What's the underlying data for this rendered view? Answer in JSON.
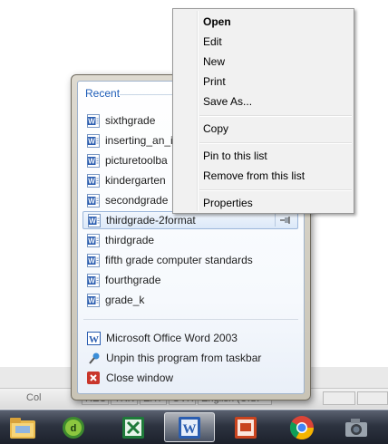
{
  "context_menu": {
    "items": [
      "Open",
      "Edit",
      "New",
      "Print",
      "Save As...",
      "Copy",
      "Pin to this list",
      "Remove from this list",
      "Properties"
    ]
  },
  "jumplist": {
    "header": "Recent",
    "recent": [
      "sixthgrade",
      "inserting_an_i",
      "picturetoolba",
      "kindergarten",
      "secondgrade",
      "thirdgrade-2format",
      "thirdgrade",
      "fifth grade computer standards",
      "fourthgrade",
      "grade_k"
    ],
    "selected_index": 5,
    "tasks": [
      {
        "label": "Microsoft Office Word 2003",
        "icon": "word-icon"
      },
      {
        "label": "Unpin this program from taskbar",
        "icon": "unpin-icon"
      },
      {
        "label": "Close window",
        "icon": "close-icon"
      }
    ]
  },
  "statusbar": {
    "col_label": "Col",
    "rec": "REC",
    "trk": "TRK",
    "ext": "EXT",
    "ovr": "OVR",
    "language": "English (U.S."
  },
  "taskbar": {
    "apps": [
      {
        "name": "windows-explorer",
        "icon": "folder-icon"
      },
      {
        "name": "dreamweaver",
        "icon": "dreamweaver-icon"
      },
      {
        "name": "excel",
        "icon": "excel-icon"
      },
      {
        "name": "word",
        "icon": "word-icon",
        "active": true
      },
      {
        "name": "powerpoint",
        "icon": "powerpoint-icon"
      },
      {
        "name": "chrome",
        "icon": "chrome-icon"
      },
      {
        "name": "camera",
        "icon": "camera-icon"
      }
    ]
  },
  "colors": {
    "accent_header": "#1e5db8",
    "selected_bg": "#dbe8f8",
    "taskbar": "#2d3340"
  }
}
